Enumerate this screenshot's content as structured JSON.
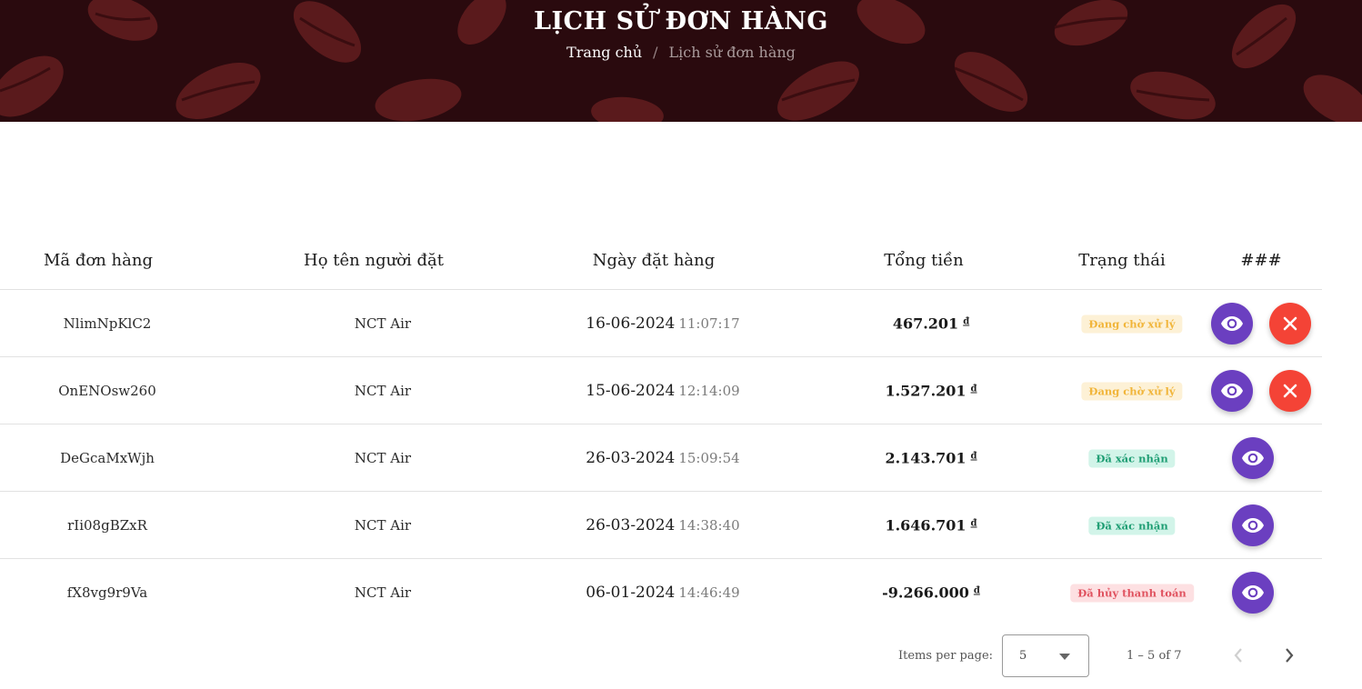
{
  "banner": {
    "title": "LỊCH SỬ ĐƠN HÀNG",
    "breadcrumb_home": "Trang chủ",
    "breadcrumb_separator": "/",
    "breadcrumb_current": "Lịch sử đơn hàng"
  },
  "table": {
    "headers": [
      "Mã đơn hàng",
      "Họ tên người đặt",
      "Ngày đặt hàng",
      "Tổng tiền",
      "Trạng thái",
      "###"
    ],
    "currency_symbol": "đ",
    "rows": [
      {
        "code": "NlimNpKlC2",
        "name": "NCT Air",
        "date": "16-06-2024",
        "time": "11:07:17",
        "total": "467.201",
        "status": "Đang chờ xử lý",
        "status_type": "pending",
        "actions": [
          "view",
          "cancel"
        ]
      },
      {
        "code": "OnENOsw260",
        "name": "NCT Air",
        "date": "15-06-2024",
        "time": "12:14:09",
        "total": "1.527.201",
        "status": "Đang chờ xử lý",
        "status_type": "pending",
        "actions": [
          "view",
          "cancel"
        ]
      },
      {
        "code": "DeGcaMxWjh",
        "name": "NCT Air",
        "date": "26-03-2024",
        "time": "15:09:54",
        "total": "2.143.701",
        "status": "Đã xác nhận",
        "status_type": "confirmed",
        "actions": [
          "view"
        ]
      },
      {
        "code": "rIi08gBZxR",
        "name": "NCT Air",
        "date": "26-03-2024",
        "time": "14:38:40",
        "total": "1.646.701",
        "status": "Đã xác nhận",
        "status_type": "confirmed",
        "actions": [
          "view"
        ]
      },
      {
        "code": "fX8vg9r9Va",
        "name": "NCT Air",
        "date": "06-01-2024",
        "time": "14:46:49",
        "total": "-9.266.000",
        "status": "Đã hủy thanh toán",
        "status_type": "cancelled",
        "actions": [
          "view"
        ]
      }
    ]
  },
  "paginator": {
    "items_per_page_label": "Items per page:",
    "items_per_page_value": "5",
    "range_label": "1 – 5 of 7"
  },
  "icons": {
    "view": "eye-icon",
    "cancel": "close-icon",
    "dropdown": "caret-down-icon",
    "prev": "chevron-left-icon",
    "next": "chevron-right-icon"
  },
  "colors": {
    "banner_bg": "#2a0a0e",
    "view_button": "#6b3fc0",
    "cancel_button": "#f44336",
    "status_pending": "#f1b53a",
    "status_confirmed": "#1f9e74",
    "status_cancelled": "#e0525f"
  }
}
